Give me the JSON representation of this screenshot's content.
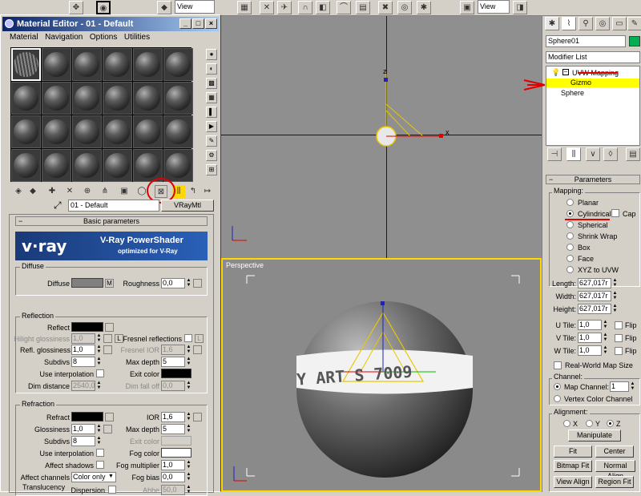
{
  "toolbar": {
    "view_label_1": "View",
    "view_label_2": "View"
  },
  "material_editor": {
    "title": "Material Editor - 01 - Default",
    "menu": [
      "Material",
      "Navigation",
      "Options",
      "Utilities"
    ],
    "material_name": "01 - Default",
    "material_type": "VRayMtl",
    "basic_params_title": "Basic parameters",
    "vray_brand": "v·ray",
    "vray_banner_title": "V-Ray PowerShader",
    "vray_banner_sub": "optimized for V-Ray",
    "diffuse": {
      "group": "Diffuse",
      "diffuse_label": "Diffuse",
      "m_label": "M",
      "roughness_label": "Roughness",
      "roughness_value": "0,0"
    },
    "reflection": {
      "group": "Reflection",
      "reflect_label": "Reflect",
      "hilight_label": "Hilight glossiness",
      "hilight_value": "1,0",
      "l_label": "L",
      "fresnel_label": "Fresnel reflections",
      "l2_label": "L",
      "refl_gloss_label": "Refl. glossiness",
      "refl_gloss_value": "1,0",
      "fresnel_ior_label": "Fresnel IOR",
      "fresnel_ior_value": "1,6",
      "subdivs_label": "Subdivs",
      "subdivs_value": "8",
      "max_depth_label": "Max depth",
      "max_depth_value": "5",
      "use_interp_label": "Use interpolation",
      "exit_color_label": "Exit color",
      "dim_dist_label": "Dim distance",
      "dim_dist_value": "2540,0",
      "dim_falloff_label": "Dim fall off",
      "dim_falloff_value": "0,0"
    },
    "refraction": {
      "group": "Refraction",
      "refract_label": "Refract",
      "ior_label": "IOR",
      "ior_value": "1,6",
      "gloss_label": "Glossiness",
      "gloss_value": "1,0",
      "max_depth_label": "Max depth",
      "max_depth_value": "5",
      "subdivs_label": "Subdivs",
      "subdivs_value": "8",
      "exit_color_label": "Exit color",
      "use_interp_label": "Use interpolation",
      "fog_color_label": "Fog color",
      "affect_shadows_label": "Affect shadows",
      "fog_mult_label": "Fog multiplier",
      "fog_mult_value": "1,0",
      "affect_channels_label": "Affect channels",
      "affect_channels_value": "Color only",
      "fog_bias_label": "Fog bias",
      "fog_bias_value": "0,0",
      "dispersion_label": "Dispersion",
      "abbe_label": "Abbe",
      "abbe_value": "50,0"
    },
    "translucency_label": "Translucency"
  },
  "viewport": {
    "perspective_label": "Perspective",
    "axis_z": "z",
    "axis_x": "x",
    "texture_text": "Y ART S 7009"
  },
  "command_panel": {
    "object_name": "Sphere01",
    "modifier_list": "Modifier List",
    "stack": [
      {
        "label": "UVW Mapping"
      },
      {
        "label": "Gizmo"
      },
      {
        "label": "Sphere"
      }
    ],
    "parameters_title": "Parameters",
    "mapping_label": "Mapping:",
    "mapping_options": [
      "Planar",
      "Cylindrical",
      "Spherical",
      "Shrink Wrap",
      "Box",
      "Face",
      "XYZ to UVW"
    ],
    "mapping_selected": "Cylindrical",
    "cap_label": "Cap",
    "length_label": "Length:",
    "length_value": "627,017r",
    "width_label": "Width:",
    "width_value": "627,017r",
    "height_label": "Height:",
    "height_value": "627,017r",
    "utile_label": "U Tile:",
    "utile_value": "1,0",
    "vtile_label": "V Tile:",
    "vtile_value": "1,0",
    "wtile_label": "W Tile:",
    "wtile_value": "1,0",
    "flip_label": "Flip",
    "real_world_label": "Real-World Map Size",
    "channel_label": "Channel:",
    "map_channel_label": "Map Channel:",
    "map_channel_value": "1",
    "vertex_color_label": "Vertex Color Channel",
    "alignment_label": "Alignment:",
    "align_x": "X",
    "align_y": "Y",
    "align_z": "Z",
    "manipulate_label": "Manipulate",
    "fit_label": "Fit",
    "center_label": "Center",
    "bitmap_fit_label": "Bitmap Fit",
    "normal_align_label": "Normal Align",
    "view_align_label": "View Align",
    "region_fit_label": "Region Fit"
  },
  "colors": {
    "annotation_red": "#e00000",
    "selection_yellow": "#ffff00",
    "gizmo_yellow": "#e8c800"
  }
}
